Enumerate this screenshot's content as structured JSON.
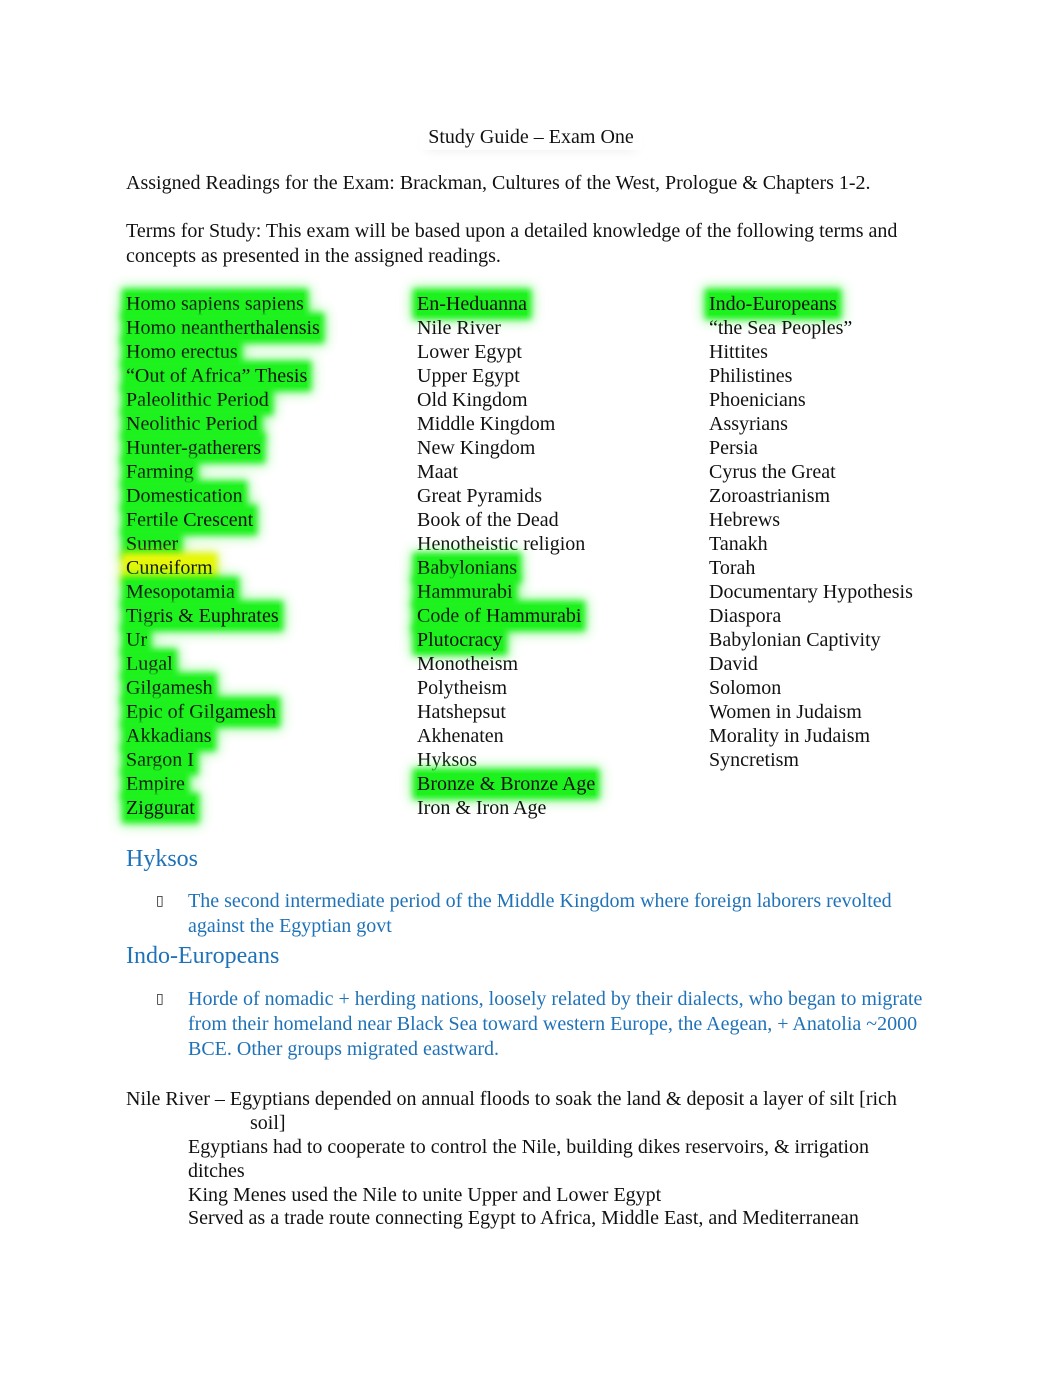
{
  "document": {
    "title": "Study Guide – Exam One",
    "readings": "Assigned Readings for the Exam: Brackman, Cultures of the West, Prologue & Chapters 1-2.",
    "terms_intro": "Terms for Study:  This exam will be based upon a detailed knowledge of the following terms and concepts as presented in the assigned readings.",
    "highlight_colors": {
      "green": "#1ef21e",
      "yellow": "#e6f70a"
    },
    "heading_color": "#1f72b8",
    "columns": [
      {
        "terms": [
          {
            "text": "Homo sapiens sapiens",
            "highlight": "green"
          },
          {
            "text": "Homo neantherthalensis",
            "highlight": "green"
          },
          {
            "text": "Homo erectus",
            "highlight": "green"
          },
          {
            "text": "“Out of Africa” Thesis",
            "highlight": "green"
          },
          {
            "text": "Paleolithic Period",
            "highlight": "green"
          },
          {
            "text": "Neolithic Period",
            "highlight": "green"
          },
          {
            "text": "Hunter-gatherers",
            "highlight": "green"
          },
          {
            "text": "Farming",
            "highlight": "green"
          },
          {
            "text": "Domestication",
            "highlight": "green"
          },
          {
            "text": "Fertile Crescent",
            "highlight": "green"
          },
          {
            "text": "Sumer",
            "highlight": "green"
          },
          {
            "text": "Cuneiform",
            "highlight": "yellow"
          },
          {
            "text": "Mesopotamia",
            "highlight": "green"
          },
          {
            "text": "Tigris & Euphrates",
            "highlight": "green"
          },
          {
            "text": "Ur",
            "highlight": "green"
          },
          {
            "text": "Lugal",
            "highlight": "green"
          },
          {
            "text": "Gilgamesh",
            "highlight": "green"
          },
          {
            "text": "Epic of Gilgamesh",
            "highlight": "green"
          },
          {
            "text": "Akkadians",
            "highlight": "green"
          },
          {
            "text": "Sargon I",
            "highlight": "green"
          },
          {
            "text": "Empire",
            "highlight": "green"
          },
          {
            "text": "Ziggurat",
            "highlight": "green"
          }
        ]
      },
      {
        "terms": [
          {
            "text": "En-Heduanna",
            "highlight": "green"
          },
          {
            "text": "Nile River",
            "highlight": "none"
          },
          {
            "text": "Lower Egypt",
            "highlight": "none"
          },
          {
            "text": "Upper Egypt",
            "highlight": "none"
          },
          {
            "text": "Old Kingdom",
            "highlight": "none"
          },
          {
            "text": "Middle Kingdom",
            "highlight": "none"
          },
          {
            "text": "New Kingdom",
            "highlight": "none"
          },
          {
            "text": "Maat",
            "highlight": "none"
          },
          {
            "text": "Great Pyramids",
            "highlight": "none"
          },
          {
            "text": "Book of the Dead",
            "highlight": "none"
          },
          {
            "text": "Henotheistic religion",
            "highlight": "none"
          },
          {
            "text": "Babylonians",
            "highlight": "green"
          },
          {
            "text": "Hammurabi",
            "highlight": "green"
          },
          {
            "text": "Code of Hammurabi",
            "highlight": "green"
          },
          {
            "text": "Plutocracy",
            "highlight": "green"
          },
          {
            "text": "Monotheism",
            "highlight": "none"
          },
          {
            "text": "Polytheism",
            "highlight": "none"
          },
          {
            "text": "Hatshepsut",
            "highlight": "none"
          },
          {
            "text": "Akhenaten",
            "highlight": "none"
          },
          {
            "text": "Hyksos",
            "highlight": "none"
          },
          {
            "text": "Bronze & Bronze Age",
            "highlight": "green"
          },
          {
            "text": "Iron & Iron Age",
            "highlight": "none"
          }
        ]
      },
      {
        "terms": [
          {
            "text": "Indo-Europeans",
            "highlight": "green"
          },
          {
            "text": "“the Sea Peoples”",
            "highlight": "none"
          },
          {
            "text": "Hittites",
            "highlight": "none"
          },
          {
            "text": "Philistines",
            "highlight": "none"
          },
          {
            "text": "Phoenicians",
            "highlight": "none"
          },
          {
            "text": "Assyrians",
            "highlight": "none"
          },
          {
            "text": "Persia",
            "highlight": "none"
          },
          {
            "text": "Cyrus the Great",
            "highlight": "none"
          },
          {
            "text": "Zoroastrianism",
            "highlight": "none"
          },
          {
            "text": "Hebrews",
            "highlight": "none"
          },
          {
            "text": "Tanakh",
            "highlight": "none"
          },
          {
            "text": "Torah",
            "highlight": "none"
          },
          {
            "text": "Documentary Hypothesis",
            "highlight": "none"
          },
          {
            "text": "Diaspora",
            "highlight": "none"
          },
          {
            "text": "Babylonian Captivity",
            "highlight": "none"
          },
          {
            "text": "David",
            "highlight": "none"
          },
          {
            "text": "Solomon",
            "highlight": "none"
          },
          {
            "text": "Women in Judaism",
            "highlight": "none"
          },
          {
            "text": "Morality in Judaism",
            "highlight": "none"
          },
          {
            "text": "Syncretism",
            "highlight": "none"
          }
        ]
      }
    ],
    "notes": {
      "hyksos": {
        "heading": "Hyksos",
        "bullet_glyph": "▯",
        "text": "The second intermediate period of the Middle Kingdom where foreign laborers revolted against the Egyptian govt"
      },
      "indo_europeans": {
        "heading": "Indo-Europeans",
        "bullet_glyph": "▯",
        "text": "Horde of nomadic + herding nations, loosely related by their dialects, who began to migrate from their homeland near Black Sea toward western Europe, the Aegean, + Anatolia ~2000 BCE. Other groups migrated eastward."
      },
      "nile": {
        "line1": "Nile River – Egyptians depended on annual floods to soak the land & deposit a layer of silt [rich",
        "line1_cont": "soil]",
        "sub": [
          "Egyptians had to cooperate to control the Nile, building dikes reservoirs, & irrigation ditches",
          "King Menes used the Nile to unite Upper and Lower Egypt",
          "Served as a trade route connecting Egypt to Africa, Middle East, and Mediterranean"
        ]
      }
    }
  }
}
